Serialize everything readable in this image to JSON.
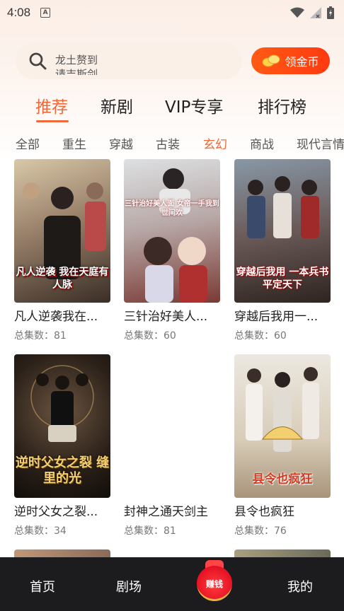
{
  "status_bar": {
    "time": "4:08",
    "app_icon_letter": "A"
  },
  "search": {
    "line1": "龙土赘到",
    "line2": "请吉斯剑"
  },
  "earn_button": {
    "label": "领金币"
  },
  "main_tabs": [
    {
      "label": "推荐",
      "active": true
    },
    {
      "label": "新剧",
      "active": false
    },
    {
      "label": "VIP专享",
      "active": false
    },
    {
      "label": "排行榜",
      "active": false
    }
  ],
  "categories": [
    {
      "label": "全部",
      "active": false
    },
    {
      "label": "重生",
      "active": false
    },
    {
      "label": "穿越",
      "active": false
    },
    {
      "label": "古装",
      "active": false
    },
    {
      "label": "玄幻",
      "active": true
    },
    {
      "label": "商战",
      "active": false
    },
    {
      "label": "现代言情",
      "active": false
    }
  ],
  "dramas": [
    {
      "title": "凡人逆袭我在...",
      "count": "总集数：81",
      "poster_text": "凡人逆袭 我在天庭有人脉",
      "colors": [
        "#c9b89a",
        "#4a3b2c"
      ]
    },
    {
      "title": "三针治好美人...",
      "count": "总集数：60",
      "poster_text": "三针治好美人面 女帝一手我到世间欢",
      "colors": [
        "#cfd3d6",
        "#8a4a4a"
      ]
    },
    {
      "title": "穿越后我用一...",
      "count": "总集数：60",
      "poster_text": "穿越后我用 一本兵书 平定天下",
      "colors": [
        "#7a8a96",
        "#3b2c28"
      ]
    },
    {
      "title": "逆时父女之裂...",
      "count": "总集数：34",
      "poster_text": "逆时父女之裂 缝里的光",
      "colors": [
        "#5a4a3a",
        "#1a1410"
      ]
    },
    {
      "title": "封神之通天剑主",
      "count": "总集数：81",
      "poster_text": "",
      "colors": [
        "#ffffff",
        "#ffffff"
      ]
    },
    {
      "title": "县令也疯狂",
      "count": "总集数：76",
      "poster_text": "县令也疯狂",
      "colors": [
        "#e3dfd6",
        "#a89880"
      ]
    }
  ],
  "bottom_nav": {
    "home": "首页",
    "theater": "剧场",
    "earn": "赚钱",
    "mine": "我的"
  }
}
